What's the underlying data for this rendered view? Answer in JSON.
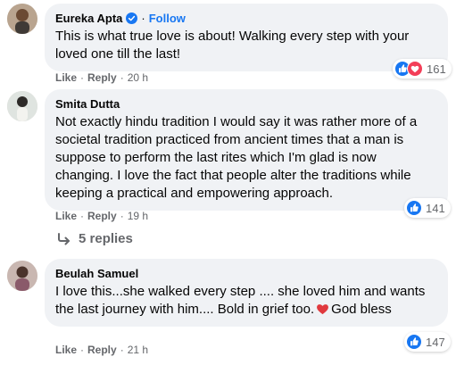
{
  "comments": [
    {
      "author": "Eureka Apta",
      "verified": true,
      "separator": "·",
      "follow_label": "Follow",
      "text": "This is what true love is about! Walking every step with your loved one till the last!",
      "like_label": "Like",
      "reply_label": "Reply",
      "time": "20 h",
      "reactions": [
        "like-icon",
        "love-icon"
      ],
      "reaction_count": "161"
    },
    {
      "author": "Smita Dutta",
      "text": "Not exactly hindu tradition I would say it was rather more of a societal tradition practiced from ancient times that a man is suppose to perform the last rites which I'm glad is now changing. I love the fact that people alter the traditions while keeping a practical and empowering approach.",
      "like_label": "Like",
      "reply_label": "Reply",
      "time": "19 h",
      "reactions": [
        "like-icon"
      ],
      "reaction_count": "141",
      "replies_label": "5 replies"
    },
    {
      "author": "Beulah Samuel",
      "text_before_emoji": "I love this...she walked every step .... she loved him and wants the last journey with him.... Bold in grief too.",
      "text_after_emoji": "God bless",
      "like_label": "Like",
      "reply_label": "Reply",
      "time": "21 h",
      "reactions": [
        "like-icon"
      ],
      "reaction_count": "147"
    }
  ],
  "action_separator": "·",
  "colors": {
    "bubble": "#f0f2f5",
    "accent": "#1877f2",
    "secondary_text": "#65676b",
    "love": "#f33e58",
    "heart_emoji": "#e0393e"
  }
}
